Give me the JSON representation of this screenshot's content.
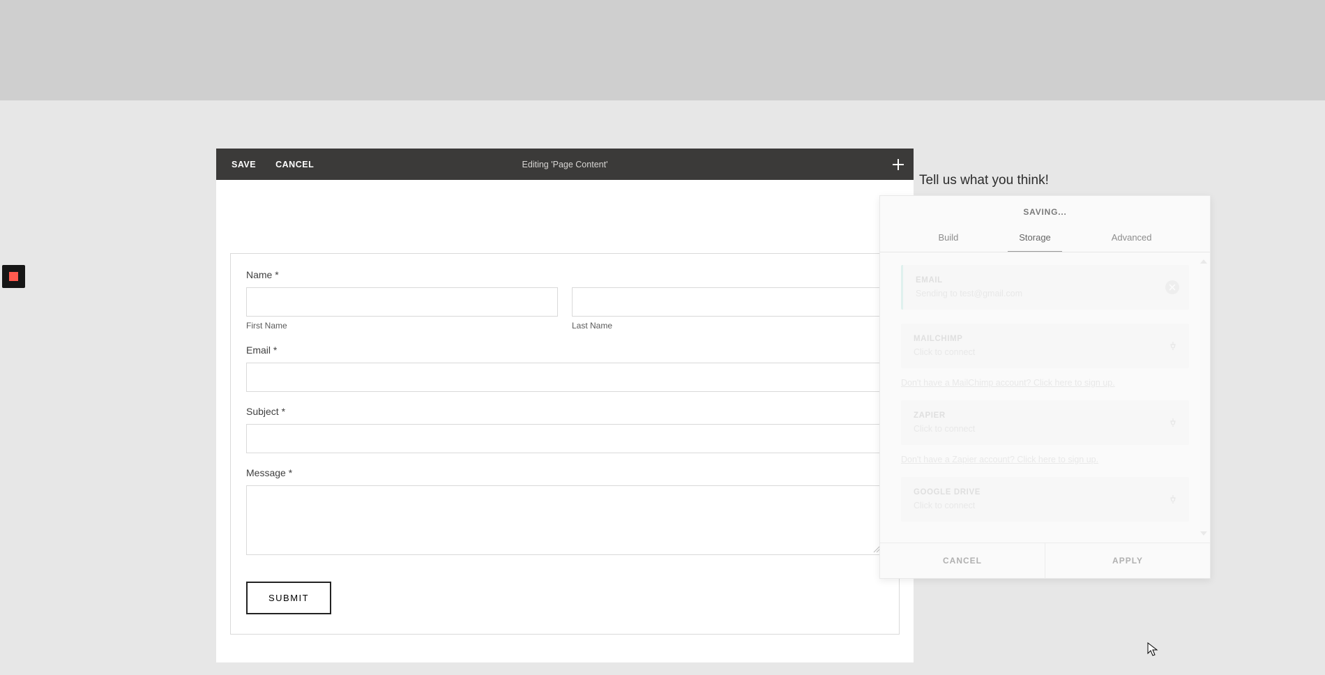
{
  "toolbar": {
    "save": "SAVE",
    "cancel": "CANCEL",
    "title": "Editing 'Page Content'"
  },
  "form": {
    "name_label": "Name *",
    "first_name_label": "First Name",
    "last_name_label": "Last Name",
    "email_label": "Email *",
    "subject_label": "Subject *",
    "message_label": "Message *",
    "submit_label": "SUBMIT"
  },
  "feedback_prompt": "Tell us what you think!",
  "panel": {
    "status": "SAVING...",
    "tabs": {
      "build": "Build",
      "storage": "Storage",
      "advanced": "Advanced"
    },
    "connections": {
      "email": {
        "title": "EMAIL",
        "sub": "Sending to test@gmail.com"
      },
      "mailchimp": {
        "title": "MAILCHIMP",
        "sub": "Click to connect",
        "signup": "Don't have a MailChimp account? Click here to sign up."
      },
      "zapier": {
        "title": "ZAPIER",
        "sub": "Click to connect",
        "signup": "Don't have a Zapier account? Click here to sign up."
      },
      "googledrive": {
        "title": "GOOGLE DRIVE",
        "sub": "Click to connect"
      }
    },
    "footer": {
      "cancel": "CANCEL",
      "apply": "APPLY"
    }
  }
}
